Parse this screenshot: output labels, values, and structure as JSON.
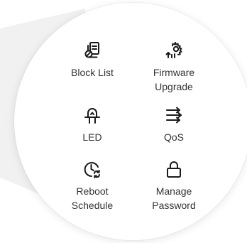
{
  "theme": {
    "icon_color": "#1a1a1a",
    "text_color": "#333333",
    "backdrop_color": "#f1f1f1"
  },
  "menu": {
    "items": [
      {
        "label": "Block List",
        "icon": "block-list-icon"
      },
      {
        "label": "Firmware\nUpgrade",
        "icon": "firmware-upgrade-icon"
      },
      {
        "label": "LED",
        "icon": "led-icon"
      },
      {
        "label": "QoS",
        "icon": "qos-icon"
      },
      {
        "label": "Reboot\nSchedule",
        "icon": "reboot-schedule-icon"
      },
      {
        "label": "Manage\nPassword",
        "icon": "lock-icon"
      }
    ]
  }
}
